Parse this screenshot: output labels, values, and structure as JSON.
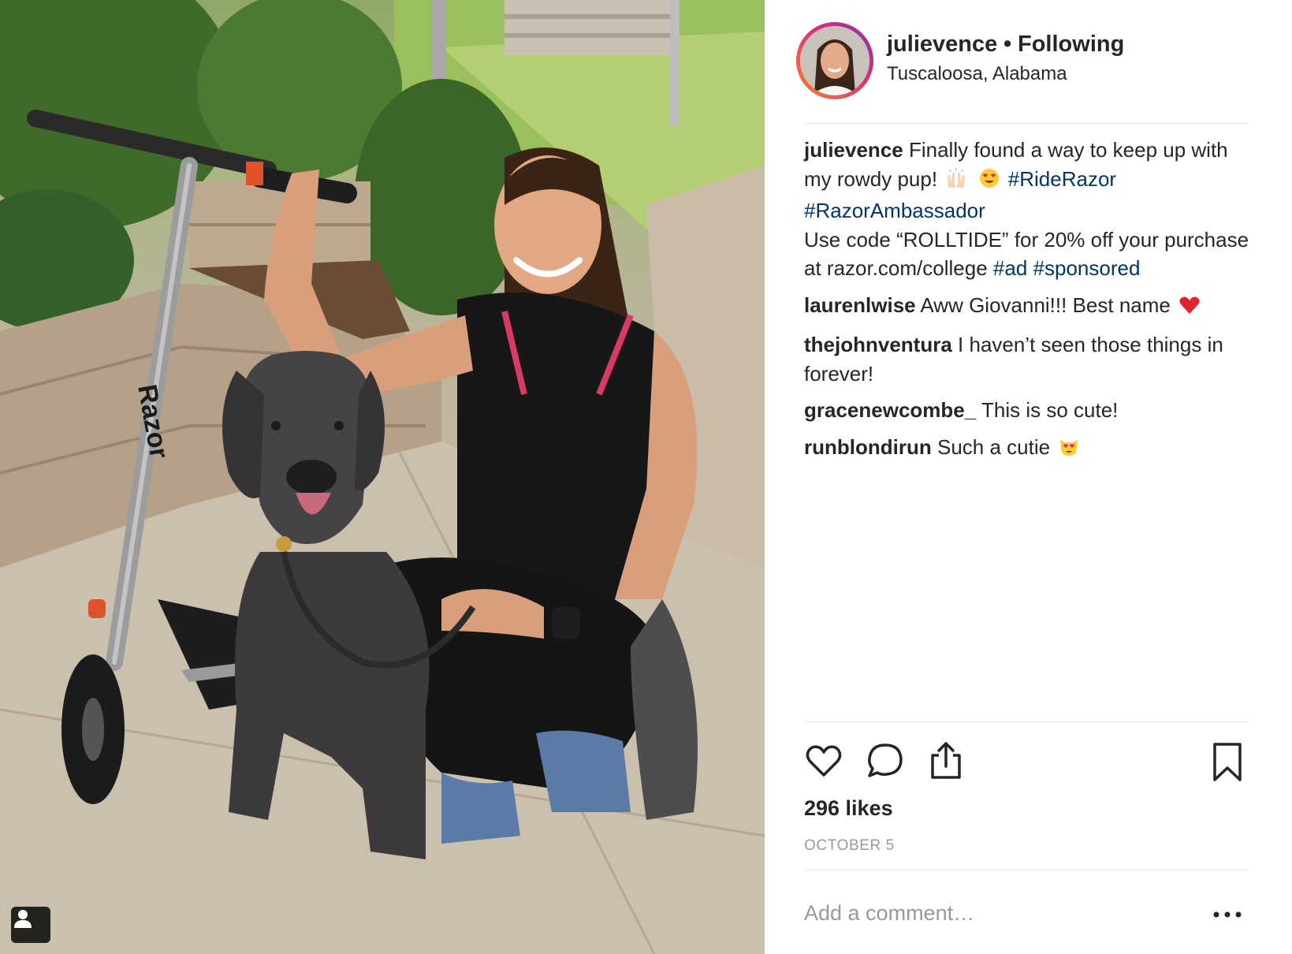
{
  "post": {
    "username": "julievence",
    "separator": "•",
    "follow_status": "Following",
    "location": "Tuscaloosa, Alabama"
  },
  "caption": {
    "username": "julievence",
    "text_1": "Finally found a way to keep up with my rowdy pup!",
    "emoji_1": "raising-hands-emoji",
    "emoji_2": "heart-eyes-emoji",
    "hashtag_1": "#RideRazor",
    "hashtag_2": "#RazorAmbassador",
    "text_2": "Use code “ROLLTIDE” for 20% off your purchase at razor.com/college",
    "hashtag_3": "#ad",
    "hashtag_4": "#sponsored"
  },
  "comments": [
    {
      "username": "laurenlwise",
      "text": "Aww Giovanni!!! Best name",
      "emoji": "red-heart-emoji"
    },
    {
      "username": "thejohnventura",
      "text": "I haven’t seen those things in forever!"
    },
    {
      "username": "gracenewcombe_",
      "text": "This is so cute!"
    },
    {
      "username": "runblondirun",
      "text": "Such a cutie",
      "emoji": "heart-eyes-cat-emoji"
    }
  ],
  "likes": "296 likes",
  "date": "OCTOBER 5",
  "comment_box": {
    "placeholder": "Add a comment…"
  },
  "more_label": "•••",
  "scooter_brand": "Razor",
  "icons": {
    "like": "heart-icon",
    "comment": "comment-bubble-icon",
    "share": "share-icon",
    "save": "bookmark-icon",
    "tag": "person-tag-icon",
    "more": "more-options-icon"
  },
  "colors": {
    "hashtag": "#003569",
    "text": "#262626",
    "muted": "#999999",
    "divider": "#e6e6e6",
    "story_ring_start": "#f58529",
    "story_ring_end": "#8134af"
  }
}
